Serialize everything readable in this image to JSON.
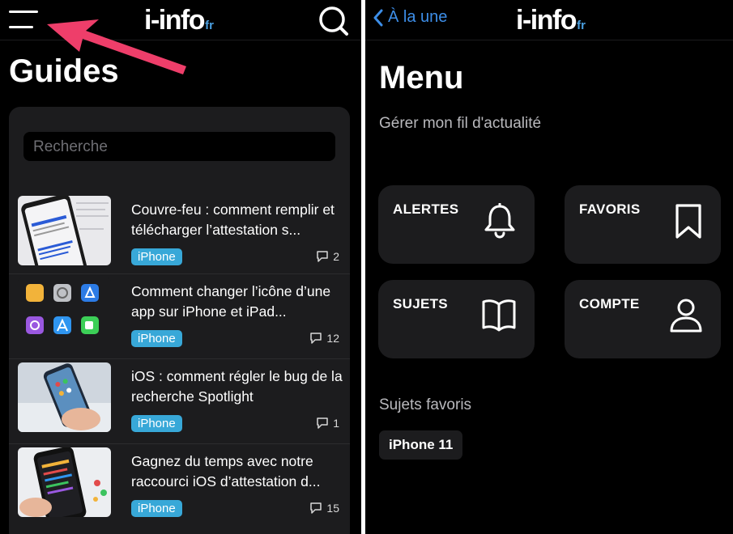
{
  "left": {
    "logo": {
      "main": "i-info",
      "suffix": "fr"
    },
    "page_title": "Guides",
    "search_placeholder": "Recherche",
    "articles": [
      {
        "title": "Couvre-feu : comment remplir et télécharger l’attestation s...",
        "tag": "iPhone",
        "comments": "2"
      },
      {
        "title": "Comment changer l’icône d’une app sur iPhone et iPad...",
        "tag": "iPhone",
        "comments": "12"
      },
      {
        "title": "iOS : comment régler le bug de la recherche Spotlight",
        "tag": "iPhone",
        "comments": "1"
      },
      {
        "title": "Gagnez du temps avec notre raccourci iOS d’attestation d...",
        "tag": "iPhone",
        "comments": "15"
      }
    ]
  },
  "right": {
    "back_label": "À la une",
    "logo": {
      "main": "i-info",
      "suffix": "fr"
    },
    "page_title": "Menu",
    "subtitle": "Gérer mon fil d'actualité",
    "tiles": [
      {
        "label": "ALERTES",
        "icon": "bell-icon"
      },
      {
        "label": "FAVORIS",
        "icon": "bookmark-icon"
      },
      {
        "label": "SUJETS",
        "icon": "book-icon"
      },
      {
        "label": "COMPTE",
        "icon": "user-icon"
      }
    ],
    "favorites_heading": "Sujets favoris",
    "favorites": [
      "iPhone 11"
    ]
  },
  "colors": {
    "background": "#000000",
    "card": "#1c1c1e",
    "tag": "#38a8d8",
    "link": "#3d8ee8",
    "annotation_arrow": "#ee3e6a"
  }
}
